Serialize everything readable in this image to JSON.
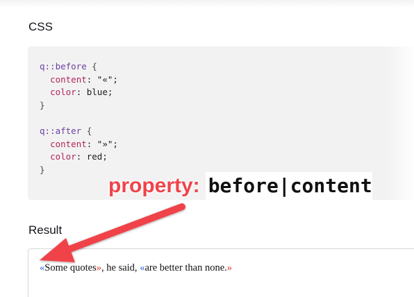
{
  "css_section": {
    "title": "CSS",
    "code": {
      "rule1_selector": "q::before",
      "rule1_open": " {",
      "rule1_prop1": "content",
      "rule1_val1": ": \"«\";",
      "rule1_prop2": "color",
      "rule1_val2": ": blue;",
      "rule1_close": "}",
      "rule2_selector": "q::after",
      "rule2_open": " {",
      "rule2_prop1": "content",
      "rule2_val1": ": \"»\";",
      "rule2_prop2": "color",
      "rule2_val2": ": red;",
      "rule2_close": "}"
    }
  },
  "result_section": {
    "title": "Result",
    "sentence": {
      "open1": "«",
      "q1": "Some quotes",
      "close1": "»",
      "middle": ", he said, ",
      "open2": "«",
      "q2": "are better than none.",
      "close2": "»"
    }
  },
  "annotation": {
    "label": "property:",
    "code": "before|content",
    "color": "#f0434a"
  },
  "colors": {
    "open_quote": "#2b5fd9",
    "close_quote": "#e0302a",
    "arrow": "#f0434a"
  }
}
